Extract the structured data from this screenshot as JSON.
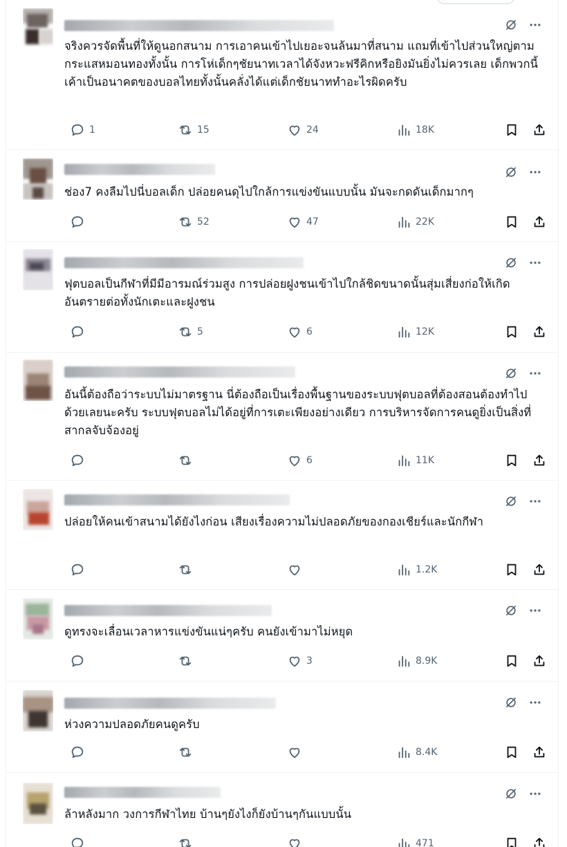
{
  "replies": [
    {
      "text": "จริงควรจัดพื้นที่ให้ดูนอกสนาม  การเอาคนเข้าไปเยอะจนล้นมาที่สนาม แถมที่เข้าไปส่วนใหญ่ตามกระแสหมอนทองทั้งนั้น  การโห่เด็กๆชัยนาทเวลาได้จังหวะฟรีคิกหรือยิงมันยิ่งไม่ควรเลย เด็กพวกนี้เค้าเป็นอนาคตของบอลไทยทั้งนั้นคลั่งได้แต่เด็กชัยนาททำอะไรผิดครับ",
      "replies": "1",
      "retweets": "15",
      "likes": "24",
      "views": "18K"
    },
    {
      "text": "ช่อง7 คงลืมไปนี่บอลเด็ก ปล่อยคนดุไปใกล้การแข่งขันแบบนั้น มันจะกดดันเด็กมากๆ",
      "replies": "",
      "retweets": "52",
      "likes": "47",
      "views": "22K"
    },
    {
      "text": "ฟุตบอลเป็นกีฬาที่มีมีอารมณ์ร่วมสูง การปล่อยฝูงชนเข้าไปใกล้ชิดขนาดนั้นสุ่มเสี่ยงก่อให้เกิดอันตรายต่อทั้งนักเตะและฝูงชน",
      "replies": "",
      "retweets": "5",
      "likes": "6",
      "views": "12K"
    },
    {
      "text": "อันนี้ต้องถือว่าระบบไม่มาตรฐาน นี่ต้องถือเป็นเรื่องพื้นฐานของระบบฟุตบอลที่ต้องสอนต้องทำไปด้วยเลยนะครับ ระบบฟุตบอลไม่ได้อยู่ที่การเตะเพียงอย่างเดียว การบริหารจัดการคนดูยิ่งเป็นสิ่งที่สากลจับจ้องอยู่",
      "replies": "",
      "retweets": "",
      "likes": "6",
      "views": "11K"
    },
    {
      "text": "ปล่อยให้คนเข้าสนามได้ยังไงก่อน  เสียงเรื่องความไม่ปลอดภัยของกองเชียร์และนักกีฬา",
      "replies": "",
      "retweets": "",
      "likes": "",
      "views": "1.2K"
    },
    {
      "text": "ดูทรงจะเลื่อนเวลาหารแข่งขันแน่ๆครับ คนยังเข้ามาไม่หยุด",
      "replies": "",
      "retweets": "",
      "likes": "3",
      "views": "8.9K"
    },
    {
      "text": "ห่วงความปลอดภัยคนดูครับ",
      "replies": "",
      "retweets": "",
      "likes": "",
      "views": "8.4K"
    },
    {
      "text": "ล้าหลังมาก วงการกีฬาไทย บ้านๆยังไงก็ยังบ้านๆกันแบบนั้น",
      "replies": "",
      "retweets": "",
      "likes": "",
      "views": "471"
    }
  ],
  "icons": {
    "reply": "reply-icon",
    "retweet": "retweet-icon",
    "like": "heart-icon",
    "views": "views-icon",
    "bookmark": "bookmark-icon",
    "share": "share-icon",
    "grok": "grok-icon",
    "more": "more-icon"
  },
  "colors": {
    "text": "#0f1419",
    "muted": "#536471",
    "divider": "#eff3f4"
  }
}
